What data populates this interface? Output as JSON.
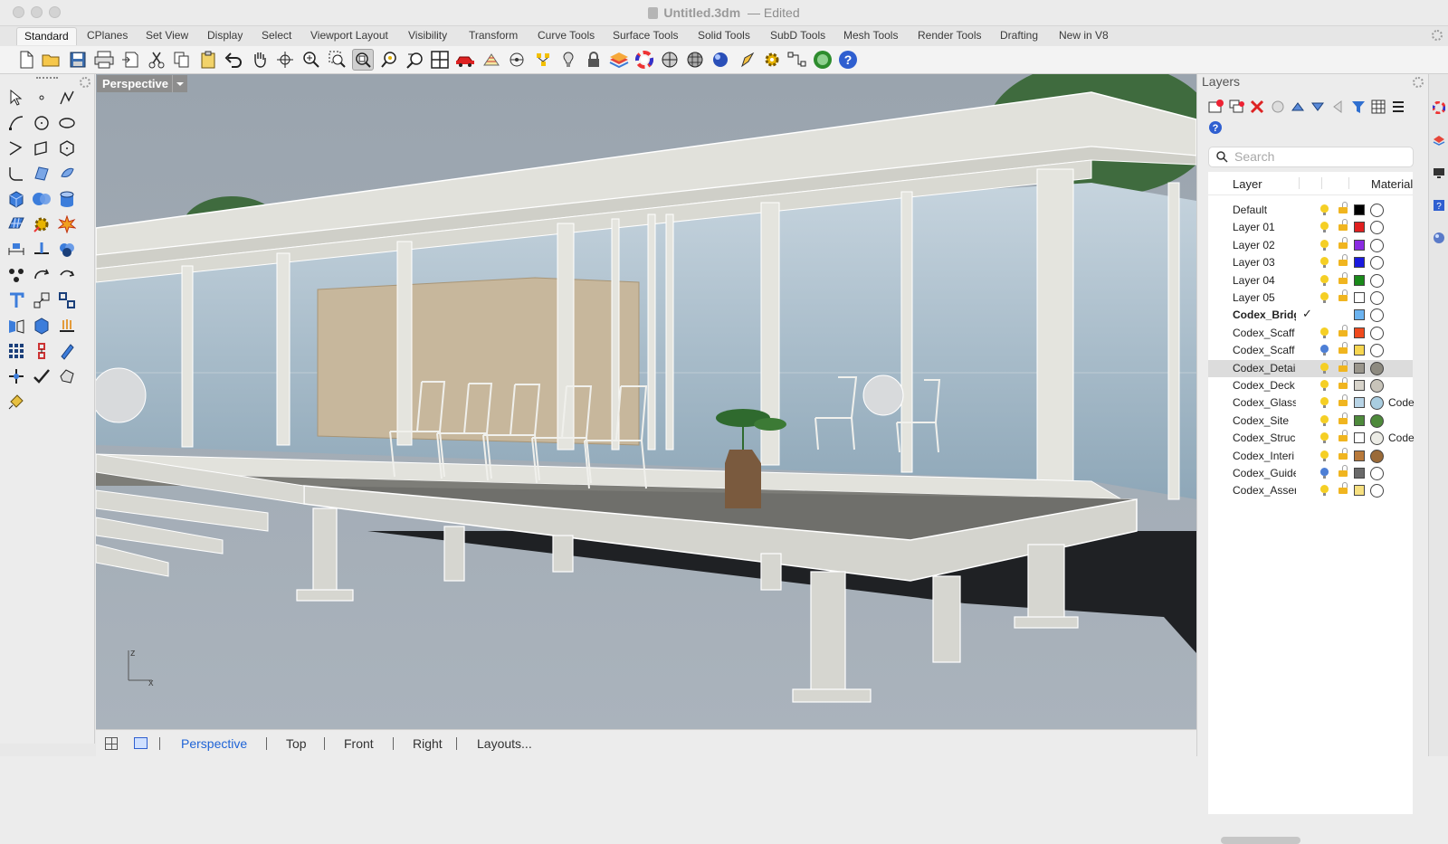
{
  "window": {
    "file_name": "Untitled.3dm",
    "status": "— Edited"
  },
  "tabs": [
    "Standard",
    "CPlanes",
    "Set View",
    "Display",
    "Select",
    "Viewport Layout",
    "Visibility",
    "Transform",
    "Curve Tools",
    "Surface Tools",
    "Solid Tools",
    "SubD Tools",
    "Mesh Tools",
    "Render Tools",
    "Drafting",
    "New in V8"
  ],
  "toolbar_icons": [
    "new-document-icon",
    "open-folder-icon",
    "save-icon",
    "print-icon",
    "import-icon",
    "cut-icon",
    "copy-icon",
    "paste-icon",
    "undo-icon",
    "pan-hand-icon",
    "rotate-view-icon",
    "zoom-icon",
    "zoom-window-icon",
    "zoom-extents-icon",
    "zoom-selected-icon",
    "undo-view-icon",
    "four-viewports-icon",
    "car-icon",
    "grid-icon",
    "osnap-icon",
    "point-icon",
    "light-icon",
    "lock-icon",
    "layer-icon",
    "color-wheel-icon",
    "shade-icon",
    "render-preview-icon",
    "sphere-render-icon",
    "pen-icon",
    "gear-icon",
    "history-icon",
    "globe-icon",
    "help-icon"
  ],
  "viewport": {
    "label": "Perspective",
    "axis_z": "z",
    "axis_x": "x"
  },
  "viewport_tabs": [
    "Perspective",
    "Top",
    "Front",
    "Right",
    "Layouts..."
  ],
  "layers_panel": {
    "title": "Layers",
    "search_placeholder": "Search",
    "col_layer": "Layer",
    "col_material": "Material",
    "rows": [
      {
        "name": "Default",
        "color": "#000000",
        "bulb": "yellow",
        "material": "",
        "mat_color": "#ffffff"
      },
      {
        "name": "Layer 01",
        "color": "#e02020",
        "bulb": "yellow",
        "material": "",
        "mat_color": "#ffffff"
      },
      {
        "name": "Layer 02",
        "color": "#8a2be2",
        "bulb": "yellow",
        "material": "",
        "mat_color": "#ffffff"
      },
      {
        "name": "Layer 03",
        "color": "#1a1adf",
        "bulb": "yellow",
        "material": "",
        "mat_color": "#ffffff"
      },
      {
        "name": "Layer 04",
        "color": "#1a8a1a",
        "bulb": "yellow",
        "material": "",
        "mat_color": "#ffffff"
      },
      {
        "name": "Layer 05",
        "color": "#ffffff",
        "bulb": "yellow",
        "material": "",
        "mat_color": "#ffffff"
      },
      {
        "name": "Codex_Bridg",
        "color": "#6bb3f0",
        "bulb": "none",
        "material": "",
        "mat_color": "#ffffff",
        "current": true
      },
      {
        "name": "Codex_Scaff",
        "color": "#f04a1e",
        "bulb": "yellow",
        "material": "",
        "mat_color": "#ffffff"
      },
      {
        "name": "Codex_Scaff",
        "color": "#f7d650",
        "bulb": "blue",
        "material": "",
        "mat_color": "#ffffff"
      },
      {
        "name": "Codex_Detai",
        "color": "#9a968c",
        "bulb": "yellow",
        "material": "",
        "mat_color": "#8d8a80",
        "selected": true
      },
      {
        "name": "Codex_Deck",
        "color": "#d8d4cb",
        "bulb": "yellow",
        "material": "",
        "mat_color": "#c8c4ba"
      },
      {
        "name": "Codex_Glass",
        "color": "#b8d4e6",
        "bulb": "yellow",
        "material": "Code",
        "mat_color": "#a9cde0"
      },
      {
        "name": "Codex_Site",
        "color": "#4e8a3b",
        "bulb": "yellow",
        "material": "",
        "mat_color": "#4e8a3b"
      },
      {
        "name": "Codex_Struc",
        "color": "#ffffff",
        "bulb": "yellow",
        "material": "Code",
        "mat_color": "#ecece6"
      },
      {
        "name": "Codex_Interi",
        "color": "#b8793a",
        "bulb": "yellow",
        "material": "",
        "mat_color": "#9a6a38"
      },
      {
        "name": "Codex_Guide",
        "color": "#6a6a6a",
        "bulb": "blue",
        "material": "",
        "mat_color": "#ffffff"
      },
      {
        "name": "Codex_Asser",
        "color": "#f7e080",
        "bulb": "yellow",
        "material": "",
        "mat_color": "#ffffff"
      }
    ]
  },
  "panel_tabs": [
    "properties-icon",
    "layers-icon",
    "display-icon",
    "help-panel-icon",
    "materials-icon"
  ]
}
